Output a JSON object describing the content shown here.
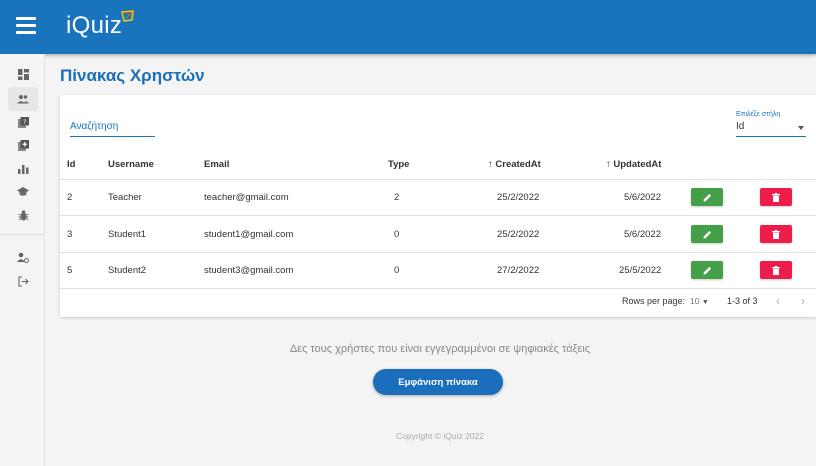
{
  "app": {
    "logo_text": "iQuiz"
  },
  "sidebar": {
    "items": [
      {
        "icon": "dashboard-icon"
      },
      {
        "icon": "users-icon"
      },
      {
        "icon": "quiz-icon"
      },
      {
        "icon": "add-box-icon"
      },
      {
        "icon": "bar-chart-icon"
      },
      {
        "icon": "school-icon"
      },
      {
        "icon": "bug-icon"
      },
      {
        "icon": "user-settings-icon"
      },
      {
        "icon": "logout-icon"
      }
    ],
    "active": "users-icon"
  },
  "page": {
    "title": "Πίνακας Χρηστών"
  },
  "table": {
    "search_placeholder": "Αναζήτηση",
    "column_select_label": "Επιλέξε στήλη",
    "column_select_value": "Id",
    "columns": [
      "Id",
      "Username",
      "Email",
      "Type",
      "↑ CreatedAt",
      "↑ UpdatedAt"
    ],
    "rows": [
      {
        "id": "2",
        "username": "Teacher",
        "email": "teacher@gmail.com",
        "type": "2",
        "created": "25/2/2022",
        "updated": "5/6/2022"
      },
      {
        "id": "3",
        "username": "Student1",
        "email": "student1@gmail.com",
        "type": "0",
        "created": "25/2/2022",
        "updated": "5/6/2022"
      },
      {
        "id": "5",
        "username": "Student2",
        "email": "student3@gmail.com",
        "type": "0",
        "created": "27/2/2022",
        "updated": "25/5/2022"
      }
    ],
    "pagination": {
      "rows_per_page_label": "Rows per page:",
      "rows_per_page_value": "10",
      "range": "1-3 of 3"
    }
  },
  "footer": {
    "info_text": "Δες τους χρήστες που είναι εγγεγραμμένοι σε ψηφιακές τάξεις",
    "show_button": "Εμφάνιση πίνακα",
    "copyright": "Copyright © iQuiz 2022"
  },
  "colors": {
    "primary": "#1a73bd",
    "edit": "#43a047",
    "delete": "#ee1c4a"
  }
}
